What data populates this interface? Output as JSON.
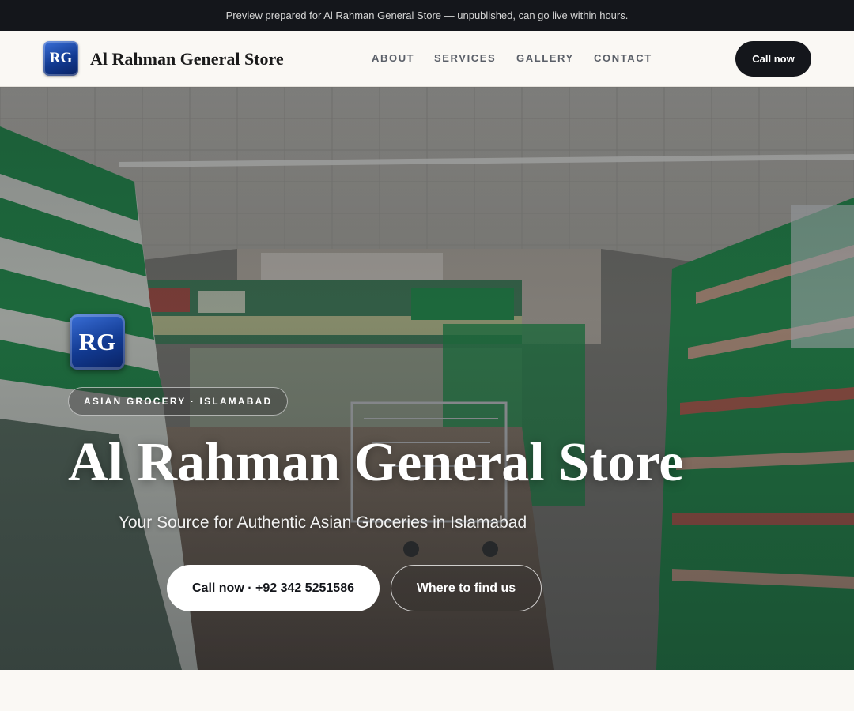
{
  "preview_bar": {
    "text": "Preview prepared for Al Rahman General Store — unpublished, can go live within hours."
  },
  "header": {
    "logo_initials": "RG",
    "brand_name": "Al Rahman General Store",
    "nav": [
      {
        "label": "ABOUT"
      },
      {
        "label": "SERVICES"
      },
      {
        "label": "GALLERY"
      },
      {
        "label": "CONTACT"
      }
    ],
    "call_button": "Call now"
  },
  "hero": {
    "background_image": "supermarket-aisle-photo",
    "logo_initials": "RG",
    "tag": "ASIAN GROCERY · ISLAMABAD",
    "title": "Al Rahman General Store",
    "subtitle": "Your Source for Authentic Asian Groceries in Islamabad",
    "primary_button": "Call now · +92 342 5251586",
    "secondary_button": "Where to find us"
  },
  "colors": {
    "dark": "#14161b",
    "page_bg": "#faf8f4",
    "nav_text": "#5a5f68",
    "badge_blue": "#123a91",
    "shelf_green": "#1f8f4a"
  }
}
